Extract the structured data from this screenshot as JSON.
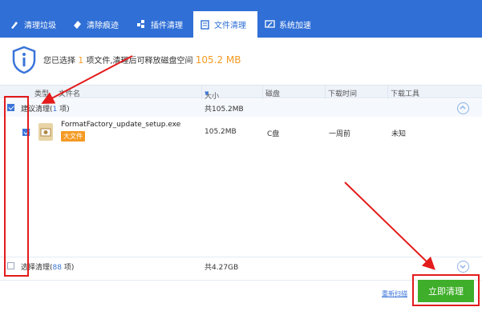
{
  "tabs": [
    {
      "label": "清理垃圾",
      "icon": "broom-icon"
    },
    {
      "label": "清除痕迹",
      "icon": "eraser-icon"
    },
    {
      "label": "插件清理",
      "icon": "plugin-icon"
    },
    {
      "label": "文件清理",
      "icon": "file-icon",
      "active": true
    },
    {
      "label": "系统加速",
      "icon": "speed-icon"
    }
  ],
  "summary": {
    "prefix": "您已选择",
    "count": "1",
    "middle": "项文件,清理后可释放磁盘空间",
    "size": "105.2 MB"
  },
  "columns": {
    "type": "类型",
    "name": "文件名",
    "size": "大小",
    "disk": "磁盘",
    "time": "下载时间",
    "tool": "下载工具"
  },
  "group_recommended": {
    "label": "建议清理",
    "count": "1",
    "unit": "项",
    "total": "共105.2MB"
  },
  "file": {
    "name": "FormatFactory_update_setup.exe",
    "badge": "大文件",
    "size": "105.2MB",
    "disk": "C盘",
    "time": "一周前",
    "tool": "未知"
  },
  "group_optional": {
    "label": "选择清理",
    "count": "88",
    "unit": "项",
    "total": "共4.27GB"
  },
  "footer": {
    "rescan": "重新扫描",
    "clean": "立即清理"
  },
  "colors": {
    "brand": "#2f6fd6",
    "accent": "#f59a23",
    "action": "#3fae2a",
    "annotation": "#e31b1b"
  }
}
